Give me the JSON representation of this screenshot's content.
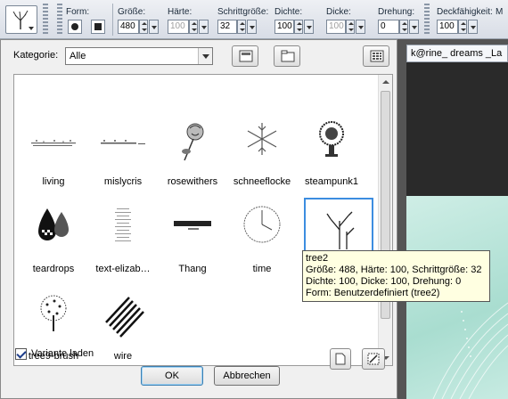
{
  "toolbar": {
    "form_label": "Form:",
    "size_label": "Größe:",
    "size_value": "480",
    "hardness_label": "Härte:",
    "hardness_value": "100",
    "step_label": "Schrittgröße:",
    "step_value": "32",
    "density_label": "Dichte:",
    "density_value": "100",
    "thickness_label": "Dicke:",
    "thickness_value": "100",
    "rotation_label": "Drehung:",
    "rotation_value": "0",
    "opacity_label": "Deckfähigkeit:",
    "opacity_value": "100",
    "extra_label": "M"
  },
  "document": {
    "title": "k@rine_ dreams _La"
  },
  "dialog": {
    "category_label": "Kategorie:",
    "category_value": "Alle",
    "brushes": [
      {
        "label": "living",
        "icon": "brush-living-icon"
      },
      {
        "label": "mislycris",
        "icon": "brush-mislycris-icon"
      },
      {
        "label": "rosewithers",
        "icon": "brush-rose-icon"
      },
      {
        "label": "schneeflocke",
        "icon": "brush-snowflake-icon"
      },
      {
        "label": "steampunk1",
        "icon": "brush-steampunk-icon"
      },
      {
        "label": "teardrops",
        "icon": "brush-teardrops-icon"
      },
      {
        "label": "text-elizab…",
        "icon": "brush-text-icon"
      },
      {
        "label": "Thang",
        "icon": "brush-thang-icon"
      },
      {
        "label": "time",
        "icon": "brush-clock-icon"
      },
      {
        "label": "tree2",
        "icon": "brush-tree-icon",
        "selected": true
      },
      {
        "label": "tree9-brush",
        "icon": "brush-tree9-icon"
      },
      {
        "label": "wire",
        "icon": "brush-wire-icon"
      }
    ],
    "tooltip": {
      "line1": "tree2",
      "line2": "Größe: 488, Härte: 100, Schrittgröße: 32",
      "line3": "Dichte: 100, Dicke: 100, Drehung: 0",
      "line4": "Form: Benutzerdefiniert (tree2)"
    },
    "variant_label": "Variante laden",
    "variant_checked": true,
    "ok_label": "OK",
    "cancel_label": "Abbrechen"
  }
}
